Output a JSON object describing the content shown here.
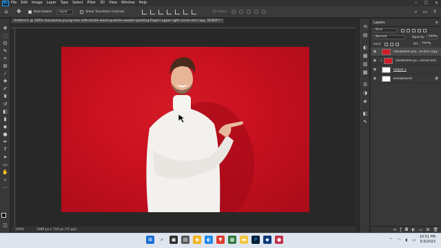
{
  "app": {
    "logo": "Ps"
  },
  "menu": [
    "File",
    "Edit",
    "Image",
    "Layer",
    "Type",
    "Select",
    "Filter",
    "3D",
    "View",
    "Window",
    "Help"
  ],
  "window_controls": [
    "─",
    "☐",
    "✕"
  ],
  "options_bar": {
    "auto_select_label": "Auto-Select:",
    "auto_select_target": "Layer",
    "transform_controls_label": "Show Transform Controls",
    "mode3d_label": "3D Mode:"
  },
  "document": {
    "tab_title": "Untitled-1 @ 100% (handsome-young-man-with-bristle-wearing-white-sweater-pointing-fingers-upper-right-corner-emi copy, RGB/8*) *",
    "zoom": "100%",
    "doc_info": "1080 px x 720 px (72 ppi)"
  },
  "layers_panel": {
    "title": "Layers",
    "filter_label": "Kind",
    "blend_mode": "Normal",
    "opacity_label": "Opacity:",
    "opacity_value": "100%",
    "lock_label": "Lock:",
    "fill_label": "Fill:",
    "fill_value": "100%",
    "layers": [
      {
        "name": "handsome-you...er-emi copy",
        "active": true,
        "thumb": "#d51c27"
      },
      {
        "name": "handsome-yo...corner-emi",
        "active": false,
        "thumb": "#d51c27"
      },
      {
        "name": "Ellipse 1",
        "active": false,
        "thumb": "#ffffff"
      },
      {
        "name": "Background",
        "active": false,
        "thumb": "#ffffff"
      }
    ]
  },
  "taskbar": {
    "time": "10:51 PM",
    "date": "5/3/2023"
  },
  "colors": {
    "photo_red": "#c8101f",
    "ps_blue": "#31a8ff"
  }
}
